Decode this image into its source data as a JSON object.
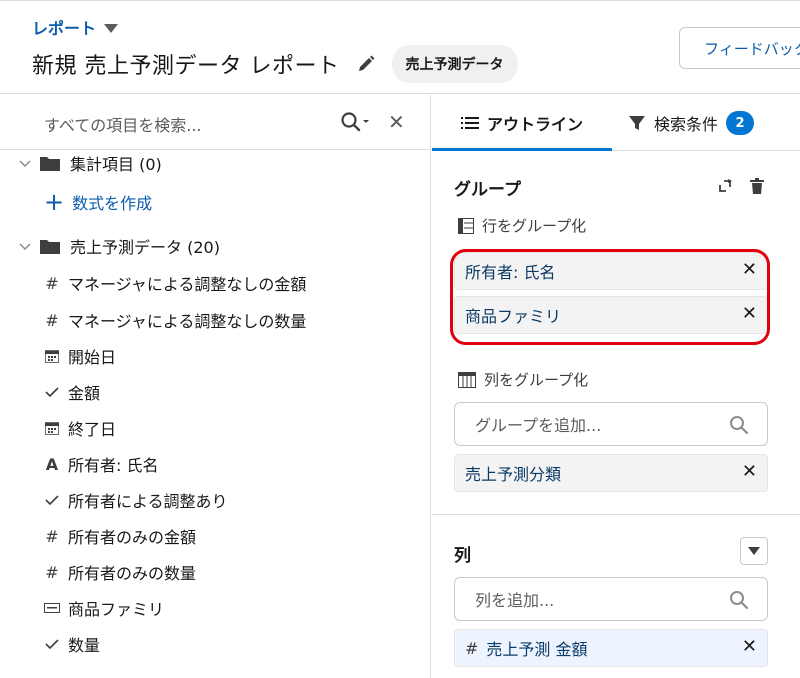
{
  "header": {
    "breadcrumb": "レポート",
    "title": "新規 売上予測データ レポート",
    "report_type_pill": "売上予測データ",
    "feedback_button": "フィードバック"
  },
  "left_panel": {
    "search_placeholder": "すべての項目を検索...",
    "tree": [
      {
        "kind": "folder",
        "label": "集計項目 (0)"
      },
      {
        "kind": "add",
        "label": "数式を作成"
      },
      {
        "kind": "folder",
        "label": "売上予測データ (20)"
      },
      {
        "kind": "field",
        "icon": "#",
        "label": "マネージャによる調整なしの金額"
      },
      {
        "kind": "field",
        "icon": "#",
        "label": "マネージャによる調整なしの数量"
      },
      {
        "kind": "field",
        "icon": "calendar-icon",
        "label": "開始日"
      },
      {
        "kind": "field",
        "icon": "check-icon",
        "label": "金額"
      },
      {
        "kind": "field",
        "icon": "calendar-icon",
        "label": "終了日"
      },
      {
        "kind": "field",
        "icon": "A",
        "label": "所有者: 氏名"
      },
      {
        "kind": "field",
        "icon": "check-icon",
        "label": "所有者による調整あり"
      },
      {
        "kind": "field",
        "icon": "#",
        "label": "所有者のみの金額"
      },
      {
        "kind": "field",
        "icon": "#",
        "label": "所有者のみの数量"
      },
      {
        "kind": "field",
        "icon": "picklist-icon",
        "label": "商品ファミリ"
      },
      {
        "kind": "field",
        "icon": "check-icon",
        "label": "数量"
      }
    ]
  },
  "right_panel": {
    "tab_outline": "アウトライン",
    "tab_filters": "検索条件",
    "filters_count": "2",
    "groups_title": "グループ",
    "row_group_label": "行をグループ化",
    "row_groups": [
      "所有者: 氏名",
      "商品ファミリ"
    ],
    "col_group_label": "列をグループ化",
    "add_group_placeholder": "グループを追加...",
    "col_groups": [
      "売上予測分類"
    ],
    "columns_title": "列",
    "add_column_placeholder": "列を追加...",
    "columns": [
      {
        "icon": "#",
        "label": "売上予測 金額"
      }
    ]
  },
  "colors": {
    "accent": "#0176d3",
    "link": "#0b5cab",
    "highlight": "#e1000f"
  }
}
